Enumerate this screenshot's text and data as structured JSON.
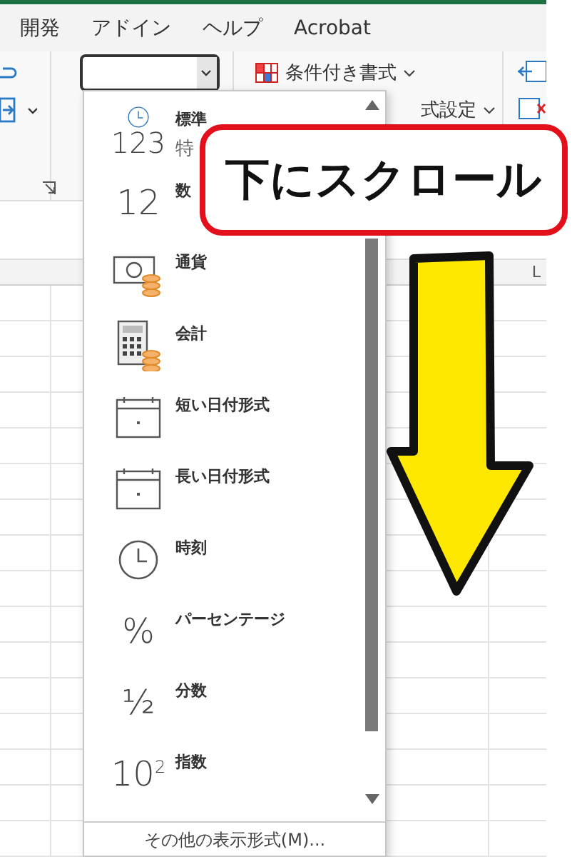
{
  "menu_tabs": [
    {
      "label": "開発"
    },
    {
      "label": "アドイン"
    },
    {
      "label": "ヘルプ"
    },
    {
      "label": "Acrobat"
    }
  ],
  "ribbon": {
    "conditional_formatting": "条件付き書式",
    "format_as_table": "式設定"
  },
  "grid": {
    "column_header": "L"
  },
  "format_menu": {
    "items": [
      {
        "kind": "general",
        "glyph": "123",
        "label": "標準",
        "sublabel": "特"
      },
      {
        "kind": "number",
        "glyph": "12",
        "label": "数"
      },
      {
        "kind": "currency",
        "label": "通貨"
      },
      {
        "kind": "accounting",
        "label": "会計"
      },
      {
        "kind": "short_date",
        "label": "短い日付形式"
      },
      {
        "kind": "long_date",
        "label": "長い日付形式"
      },
      {
        "kind": "time",
        "label": "時刻"
      },
      {
        "kind": "percent",
        "glyph": "%",
        "label": "パーセンテージ"
      },
      {
        "kind": "fraction",
        "glyph": "½",
        "label": "分数"
      },
      {
        "kind": "scientific",
        "glyph": "10$^{2}$",
        "label": "指数"
      }
    ],
    "footer": "その他の表示形式(M)..."
  },
  "callout": {
    "text": "下にスクロール"
  }
}
